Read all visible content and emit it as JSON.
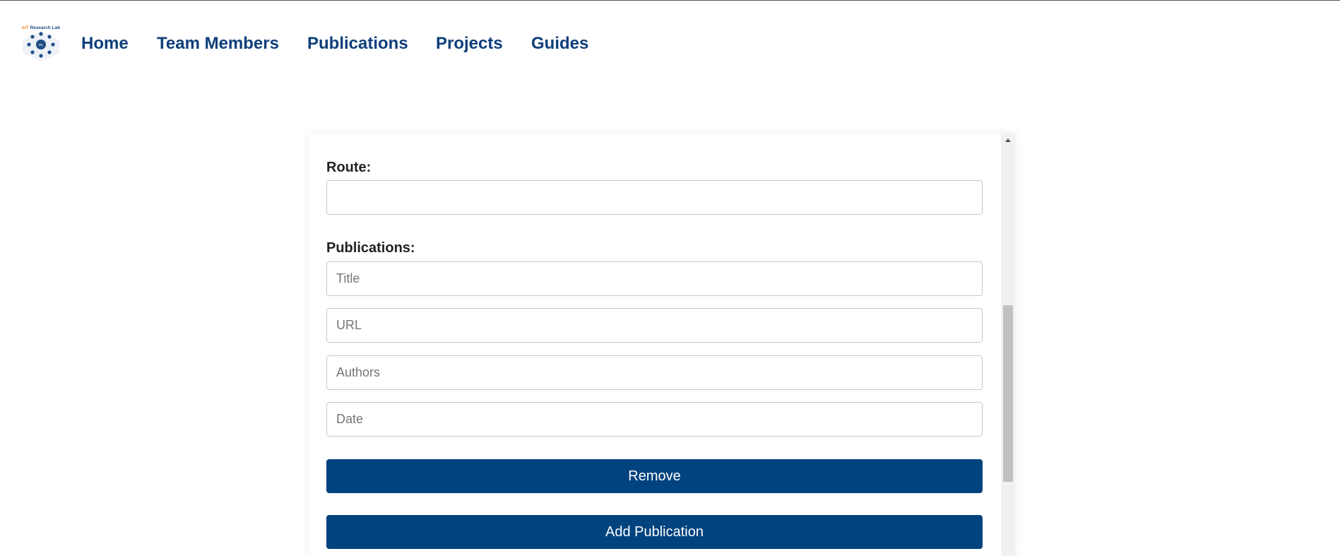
{
  "logo": {
    "text": "IoT Research Lab",
    "badge": "IRL"
  },
  "nav": {
    "items": [
      {
        "label": "Home"
      },
      {
        "label": "Team Members"
      },
      {
        "label": "Publications"
      },
      {
        "label": "Projects"
      },
      {
        "label": "Guides"
      }
    ]
  },
  "form": {
    "route_label": "Route:",
    "route_value": "",
    "publications_label": "Publications:",
    "publication_fields": {
      "title_placeholder": "Title",
      "url_placeholder": "URL",
      "authors_placeholder": "Authors",
      "date_placeholder": "Date"
    },
    "remove_label": "Remove",
    "add_label": "Add Publication"
  },
  "colors": {
    "nav_text": "#0d3f7a",
    "button_bg": "#01437e",
    "logo_orange": "#e8862a",
    "logo_blue": "#1f4e86"
  },
  "icons": {
    "scroll_up": "triangle-up-icon"
  }
}
